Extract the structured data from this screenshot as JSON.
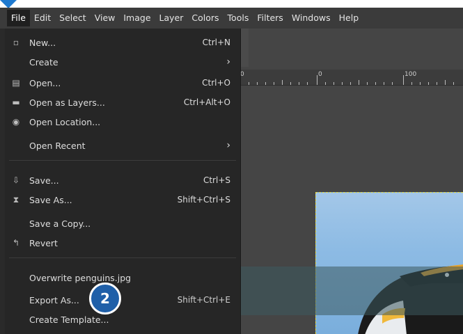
{
  "menubar": {
    "items": [
      "File",
      "Edit",
      "Select",
      "View",
      "Image",
      "Layer",
      "Colors",
      "Tools",
      "Filters",
      "Windows",
      "Help"
    ]
  },
  "file_menu": {
    "items": [
      {
        "label": "New...",
        "accel": "Ctrl+N",
        "icon": "new-file-icon"
      },
      {
        "label": "Create",
        "submenu": true
      },
      {
        "label": "Open...",
        "accel": "Ctrl+O",
        "icon": "open-icon"
      },
      {
        "label": "Open as Layers...",
        "accel": "Ctrl+Alt+O",
        "icon": "layers-icon"
      },
      {
        "label": "Open Location...",
        "icon": "globe-icon"
      },
      {
        "label": "Open Recent",
        "submenu": true
      },
      {
        "label": "Save...",
        "accel": "Ctrl+S",
        "icon": "save-icon"
      },
      {
        "label": "Save As...",
        "accel": "Shift+Ctrl+S",
        "icon": "save-as-icon"
      },
      {
        "label": "Save a Copy..."
      },
      {
        "label": "Revert",
        "icon": "revert-icon"
      },
      {
        "label": "Overwrite penguins.jpg"
      },
      {
        "label": "Export As...",
        "accel": "Shift+Ctrl+E"
      },
      {
        "label": "Create Template..."
      }
    ]
  },
  "ruler": {
    "labels": [
      "0",
      "0",
      "100"
    ]
  },
  "callout": {
    "step_number": "2"
  },
  "colors": {
    "accent": "#1f5fa8",
    "menu_bg": "#262626",
    "menubar_bg": "#3b3b3b"
  }
}
